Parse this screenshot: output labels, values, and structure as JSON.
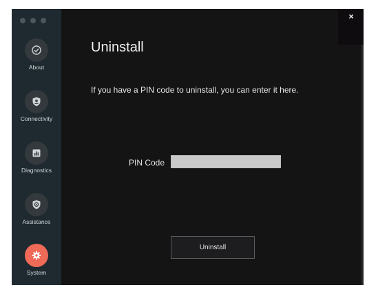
{
  "window": {
    "close_label": "×"
  },
  "sidebar": {
    "items": [
      {
        "label": "About",
        "icon": "check-circle-icon",
        "active": false
      },
      {
        "label": "Connectivity",
        "icon": "shield-person-icon",
        "active": false
      },
      {
        "label": "Diagnostics",
        "icon": "bar-chart-icon",
        "active": false
      },
      {
        "label": "Assistance",
        "icon": "shield-gear-icon",
        "active": false
      },
      {
        "label": "System",
        "icon": "gear-icon",
        "active": true
      }
    ]
  },
  "main": {
    "title": "Uninstall",
    "description": "If you have a PIN code to uninstall, you can enter it here.",
    "pin_label": "PIN Code",
    "pin_value": "",
    "button_label": "Uninstall"
  },
  "colors": {
    "window_bg": "#151414",
    "sidebar_bg": "#1e2a30",
    "active_accent": "#ef6a57",
    "input_bg": "#c9c9c9"
  }
}
